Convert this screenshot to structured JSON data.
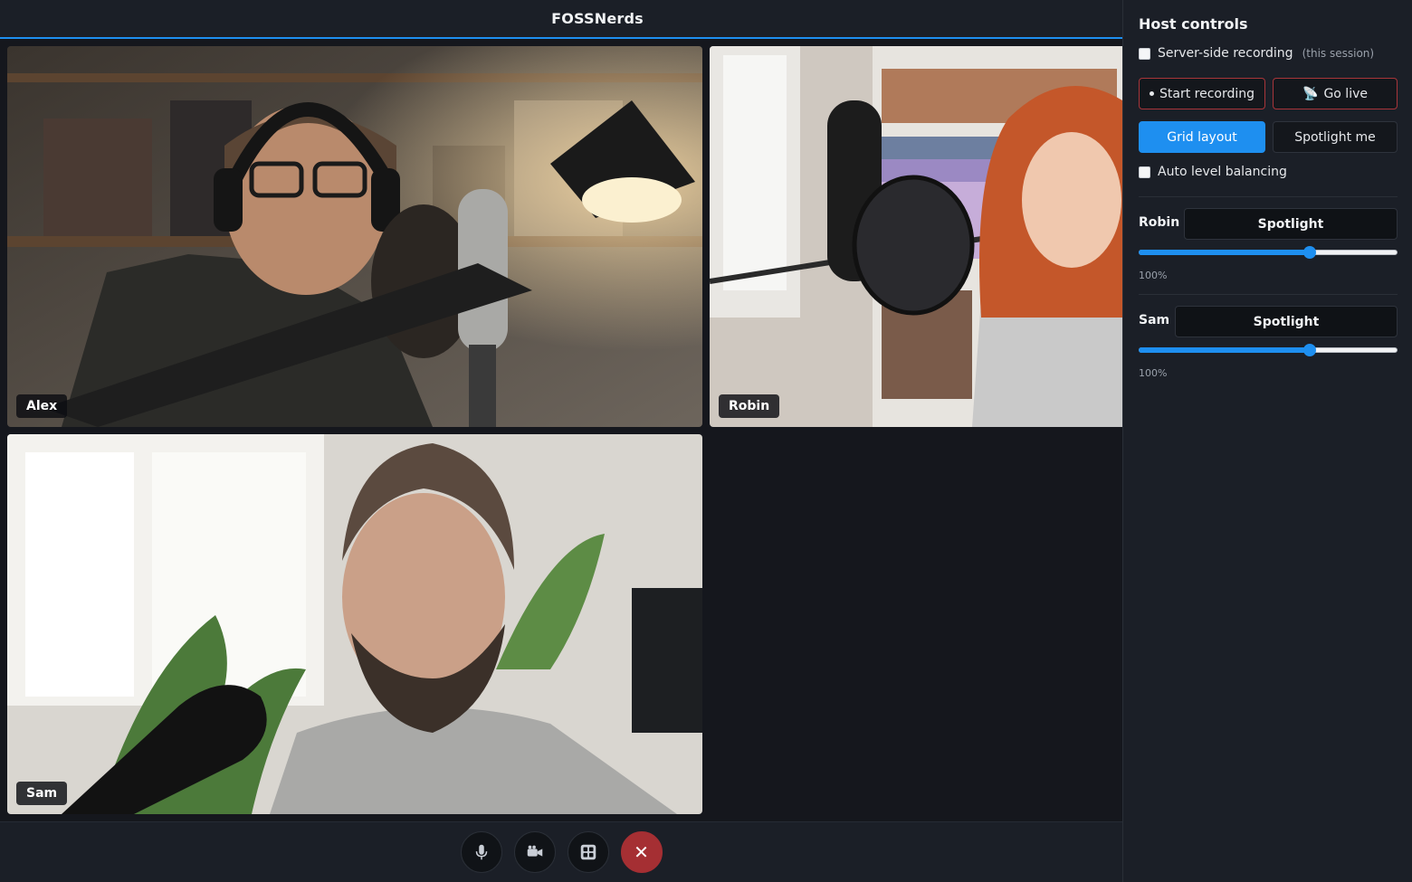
{
  "header": {
    "title": "FOSSNerds"
  },
  "participants": [
    {
      "name": "Alex"
    },
    {
      "name": "Robin"
    },
    {
      "name": "Sam"
    }
  ],
  "toolbar": {
    "mic_icon": "microphone-icon",
    "camera_icon": "video-camera-icon",
    "layout_icon": "grid-layout-icon",
    "leave_glyph": "✕"
  },
  "host_controls": {
    "title": "Host controls",
    "server_recording": {
      "label": "Server-side recording",
      "hint": "(this session)",
      "checked": false
    },
    "start_recording_label": "Start recording",
    "go_live_glyph": "📡",
    "go_live_label": "Go live",
    "grid_layout_label": "Grid layout",
    "spotlight_me_label": "Spotlight me",
    "auto_level": {
      "label": "Auto level balancing",
      "checked": false
    },
    "participants": [
      {
        "name": "Robin",
        "spotlight_label": "Spotlight",
        "volume_percent": 100,
        "volume_text": "100%",
        "slider_fraction": 0.66
      },
      {
        "name": "Sam",
        "spotlight_label": "Spotlight",
        "volume_percent": 100,
        "volume_text": "100%",
        "slider_fraction": 0.66
      }
    ]
  },
  "colors": {
    "accent": "#1e8ff0",
    "danger": "#a52f33",
    "panel": "#1b1f27",
    "background": "#15171d"
  }
}
